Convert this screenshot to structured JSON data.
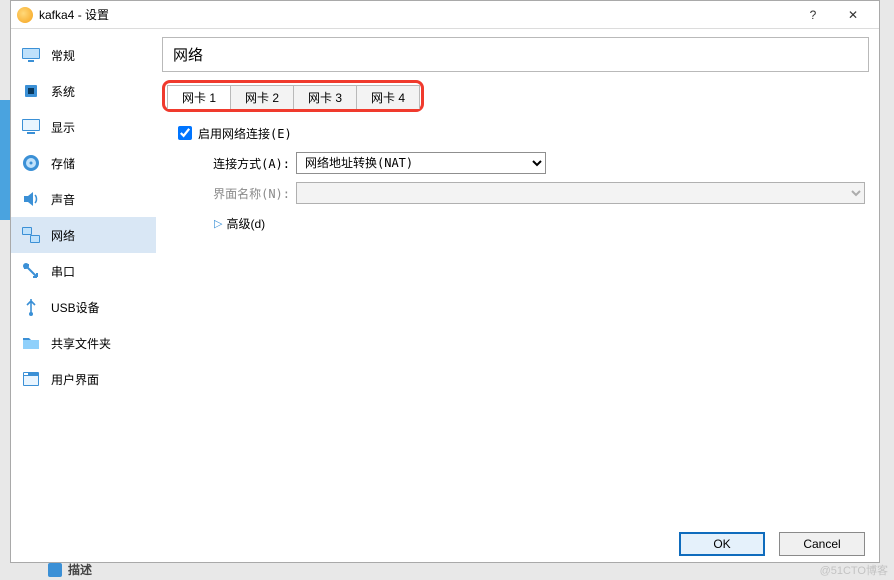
{
  "window": {
    "title": "kafka4 - 设置",
    "help": "?",
    "close": "✕"
  },
  "sidebar": {
    "items": [
      {
        "label": "常规"
      },
      {
        "label": "系统"
      },
      {
        "label": "显示"
      },
      {
        "label": "存储"
      },
      {
        "label": "声音"
      },
      {
        "label": "网络"
      },
      {
        "label": "串口"
      },
      {
        "label": "USB设备"
      },
      {
        "label": "共享文件夹"
      },
      {
        "label": "用户界面"
      }
    ]
  },
  "panel": {
    "title": "网络",
    "tabs": [
      "网卡 1",
      "网卡 2",
      "网卡 3",
      "网卡 4"
    ],
    "enable_label": "启用网络连接(E)",
    "enable_checked": true,
    "attach_label": "连接方式(A):",
    "attach_value": "网络地址转换(NAT)",
    "iface_label": "界面名称(N):",
    "iface_value": "",
    "advanced_label": "高级(d)"
  },
  "footer": {
    "ok": "OK",
    "cancel": "Cancel"
  },
  "under": {
    "label": "描述"
  },
  "watermark": "@51CTO博客"
}
